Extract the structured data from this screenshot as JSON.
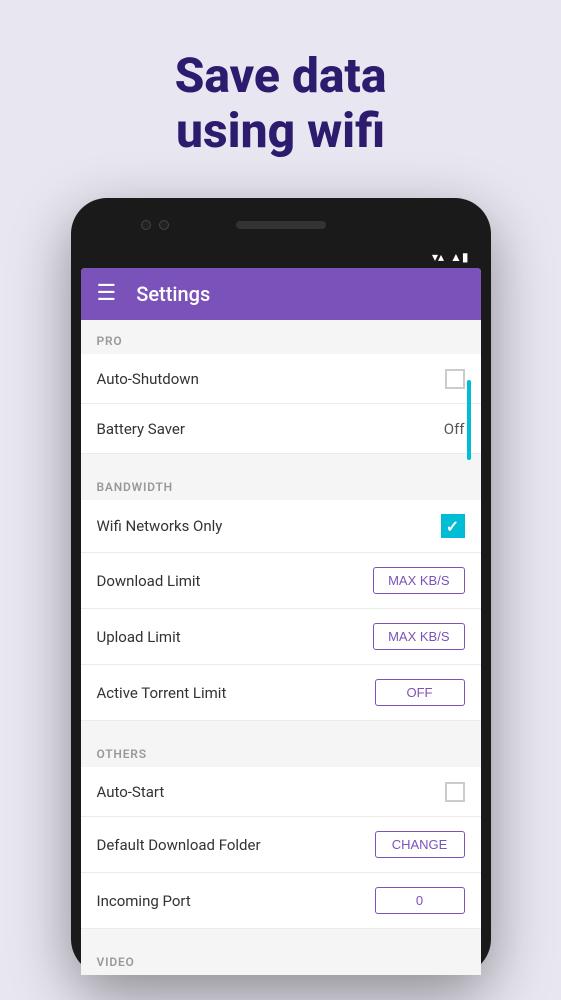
{
  "hero": {
    "line1": "Save data",
    "line2": "using wifi"
  },
  "app_bar": {
    "title": "Settings",
    "menu_icon": "☰"
  },
  "sections": [
    {
      "header": "PRO",
      "items": [
        {
          "label": "Auto-Shutdown",
          "control": "checkbox",
          "checked": false
        },
        {
          "label": "Battery Saver",
          "control": "value",
          "value": "Off"
        }
      ]
    },
    {
      "header": "BANDWIDTH",
      "items": [
        {
          "label": "Wifi Networks Only",
          "control": "checkbox-checked",
          "checked": true
        },
        {
          "label": "Download Limit",
          "control": "button",
          "button_label": "MAX KB/S"
        },
        {
          "label": "Upload Limit",
          "control": "button",
          "button_label": "MAX KB/S"
        },
        {
          "label": "Active Torrent Limit",
          "control": "button",
          "button_label": "OFF"
        }
      ]
    },
    {
      "header": "OTHERS",
      "items": [
        {
          "label": "Auto-Start",
          "control": "checkbox",
          "checked": false
        },
        {
          "label": "Default Download Folder",
          "control": "button",
          "button_label": "CHANGE"
        },
        {
          "label": "Incoming Port",
          "control": "button",
          "button_label": "0"
        }
      ]
    }
  ],
  "status_bar": {
    "wifi": "▼",
    "signal": "▲",
    "battery": "▮"
  }
}
